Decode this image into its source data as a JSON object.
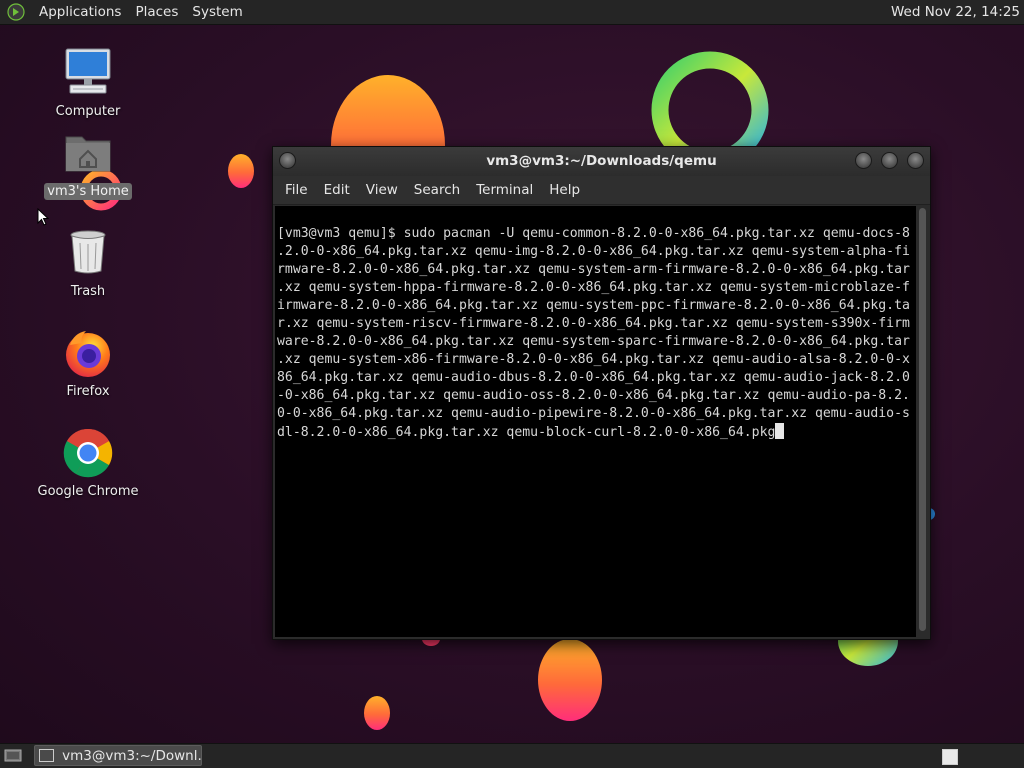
{
  "top_panel": {
    "menus": [
      "Applications",
      "Places",
      "System"
    ],
    "clock": "Wed Nov 22, 14:25",
    "logo_icon": "distro-logo-icon"
  },
  "desktop_icons": [
    {
      "name": "computer",
      "label": "Computer",
      "icon": "computer-icon"
    },
    {
      "name": "home",
      "label": "vm3's Home",
      "icon": "home-folder-icon",
      "selected": true
    },
    {
      "name": "trash",
      "label": "Trash",
      "icon": "trash-icon"
    },
    {
      "name": "firefox",
      "label": "Firefox",
      "icon": "firefox-icon"
    },
    {
      "name": "chrome",
      "label": "Google Chrome",
      "icon": "chrome-icon"
    }
  ],
  "terminal": {
    "title": "vm3@vm3:~/Downloads/qemu",
    "menus": [
      "File",
      "Edit",
      "View",
      "Search",
      "Terminal",
      "Help"
    ],
    "lines": [
      "[vm3@vm3 qemu]$ sudo pacman -U qemu-common-8.2.0-0-x86_64.pkg.tar.xz qemu-docs-8",
      ".2.0-0-x86_64.pkg.tar.xz qemu-img-8.2.0-0-x86_64.pkg.tar.xz qemu-system-alpha-fi",
      "rmware-8.2.0-0-x86_64.pkg.tar.xz qemu-system-arm-firmware-8.2.0-0-x86_64.pkg.tar",
      ".xz qemu-system-hppa-firmware-8.2.0-0-x86_64.pkg.tar.xz qemu-system-microblaze-f",
      "irmware-8.2.0-0-x86_64.pkg.tar.xz qemu-system-ppc-firmware-8.2.0-0-x86_64.pkg.ta",
      "r.xz qemu-system-riscv-firmware-8.2.0-0-x86_64.pkg.tar.xz qemu-system-s390x-firm",
      "ware-8.2.0-0-x86_64.pkg.tar.xz qemu-system-sparc-firmware-8.2.0-0-x86_64.pkg.tar",
      ".xz qemu-system-x86-firmware-8.2.0-0-x86_64.pkg.tar.xz qemu-audio-alsa-8.2.0-0-x",
      "86_64.pkg.tar.xz qemu-audio-dbus-8.2.0-0-x86_64.pkg.tar.xz qemu-audio-jack-8.2.0",
      "-0-x86_64.pkg.tar.xz qemu-audio-oss-8.2.0-0-x86_64.pkg.tar.xz qemu-audio-pa-8.2.",
      "0-0-x86_64.pkg.tar.xz qemu-audio-pipewire-8.2.0-0-x86_64.pkg.tar.xz qemu-audio-s",
      "dl-8.2.0-0-x86_64.pkg.tar.xz qemu-block-curl-8.2.0-0-x86_64.pkg"
    ]
  },
  "taskbar": {
    "window_button_label": "vm3@vm3:~/Downl...",
    "show_desktop_icon": "show-desktop-icon",
    "workspace_icon": "workspace-switcher-icon"
  },
  "colors": {
    "panel": "#252525",
    "wallpaper": "#2a0f25",
    "terminal_bg": "#000000",
    "terminal_fg": "#d7d7d7"
  }
}
